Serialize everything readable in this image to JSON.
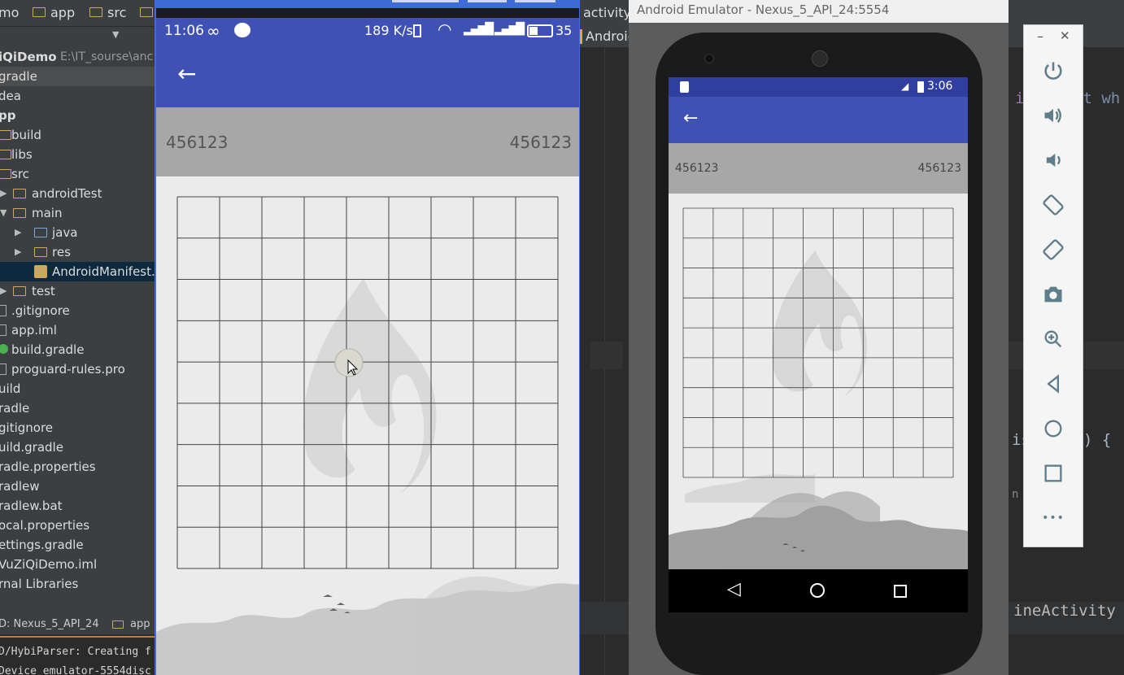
{
  "ide": {
    "breadcrumb": [
      "mo",
      "app",
      "src"
    ],
    "tree": [
      {
        "label": "iQiDemo",
        "extra": "E:\\IT_sourse\\anc"
      },
      {
        "label": "gradle"
      },
      {
        "label": "dea"
      },
      {
        "label": "pp"
      },
      {
        "label": "build"
      },
      {
        "label": "libs"
      },
      {
        "label": "src"
      },
      {
        "label": "androidTest"
      },
      {
        "label": "main"
      },
      {
        "label": "java"
      },
      {
        "label": "res"
      },
      {
        "label": "AndroidManifest."
      },
      {
        "label": "test"
      },
      {
        "label": ".gitignore"
      },
      {
        "label": "app.iml"
      },
      {
        "label": "build.gradle"
      },
      {
        "label": "proguard-rules.pro"
      },
      {
        "label": "uild"
      },
      {
        "label": "radle"
      },
      {
        "label": "gitignore"
      },
      {
        "label": "uild.gradle"
      },
      {
        "label": "radle.properties"
      },
      {
        "label": "radlew"
      },
      {
        "label": "radlew.bat"
      },
      {
        "label": "ocal.properties"
      },
      {
        "label": "ettings.gradle"
      },
      {
        "label": "VuZiQiDemo.iml"
      },
      {
        "label": "rnal Libraries"
      }
    ],
    "status_device": "D: Nexus_5_API_24",
    "status_module": "app",
    "console_lines": [
      "D/HybiParser: Creating f",
      "Device emulator-5554disc"
    ],
    "editor_tabs": [
      "activity",
      "Androic"
    ],
    "code_fragments": [
      "ia",
      "nt wh",
      "is",
      ") {",
      "n",
      "ineActivity"
    ]
  },
  "mirror": {
    "time": "11:06",
    "net_speed": "189 K/s",
    "battery": "35",
    "back_icon": "arrow-left-icon",
    "score_left": "456123",
    "score_right": "456123"
  },
  "emulator": {
    "window_title": "Android Emulator - Nexus_5_API_24:5554",
    "time": "3:06",
    "score_left": "456123",
    "score_right": "456123",
    "toolbar": [
      {
        "name": "power-icon"
      },
      {
        "name": "volume-up-icon"
      },
      {
        "name": "volume-down-icon"
      },
      {
        "name": "rotate-left-icon"
      },
      {
        "name": "rotate-right-icon"
      },
      {
        "name": "camera-icon"
      },
      {
        "name": "zoom-icon"
      },
      {
        "name": "back-icon"
      },
      {
        "name": "home-icon"
      },
      {
        "name": "overview-icon"
      },
      {
        "name": "more-icon"
      }
    ],
    "window_controls": {
      "minimize": "–",
      "close": "✕"
    },
    "more_label": "•••"
  },
  "colors": {
    "ide_bg": "#2b2b2b",
    "ide_panel": "#3c3f41",
    "app_primary": "#3f51b5",
    "app_primary_dark": "#303f9f",
    "score_bar": "#a7a7a7",
    "mirror_border": "#3d6cd9"
  }
}
